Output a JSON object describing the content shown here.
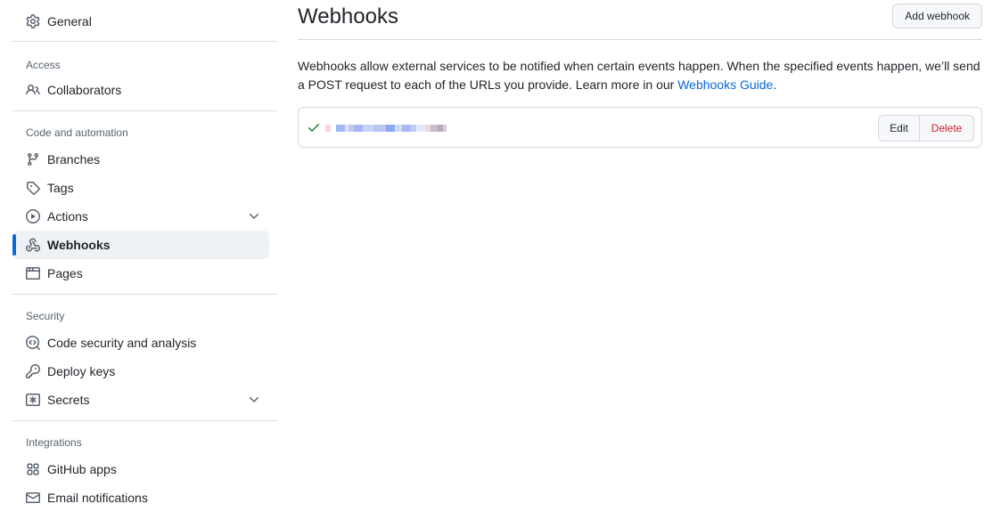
{
  "sidebar": {
    "general": {
      "label": "General",
      "icon": "gear-icon"
    },
    "access": {
      "heading": "Access",
      "items": [
        {
          "label": "Collaborators",
          "icon": "people-icon"
        }
      ]
    },
    "code_automation": {
      "heading": "Code and automation",
      "items": [
        {
          "label": "Branches",
          "icon": "git-branch-icon"
        },
        {
          "label": "Tags",
          "icon": "tag-icon"
        },
        {
          "label": "Actions",
          "icon": "play-icon",
          "expandable": true
        },
        {
          "label": "Webhooks",
          "icon": "webhook-icon",
          "active": true
        },
        {
          "label": "Pages",
          "icon": "browser-icon"
        }
      ]
    },
    "security": {
      "heading": "Security",
      "items": [
        {
          "label": "Code security and analysis",
          "icon": "codescan-icon"
        },
        {
          "label": "Deploy keys",
          "icon": "key-icon"
        },
        {
          "label": "Secrets",
          "icon": "asterisk-icon",
          "expandable": true
        }
      ]
    },
    "integrations": {
      "heading": "Integrations",
      "items": [
        {
          "label": "GitHub apps",
          "icon": "apps-icon"
        },
        {
          "label": "Email notifications",
          "icon": "mail-icon"
        }
      ]
    }
  },
  "main": {
    "title": "Webhooks",
    "add_button": "Add webhook",
    "description_prefix": "Webhooks allow external services to be notified when certain events happen. When the specified events happen, we’ll send a POST request to each of the URLs you provide. Learn more in our ",
    "description_link": "Webhooks Guide",
    "description_suffix": ".",
    "webhook": {
      "status_icon": "check-icon",
      "url": "[redacted]",
      "edit_label": "Edit",
      "delete_label": "Delete"
    }
  },
  "colors": {
    "accent": "#0969da",
    "danger": "#cf222e",
    "success": "#1a7f37",
    "active_bg": "#eff2f5"
  }
}
